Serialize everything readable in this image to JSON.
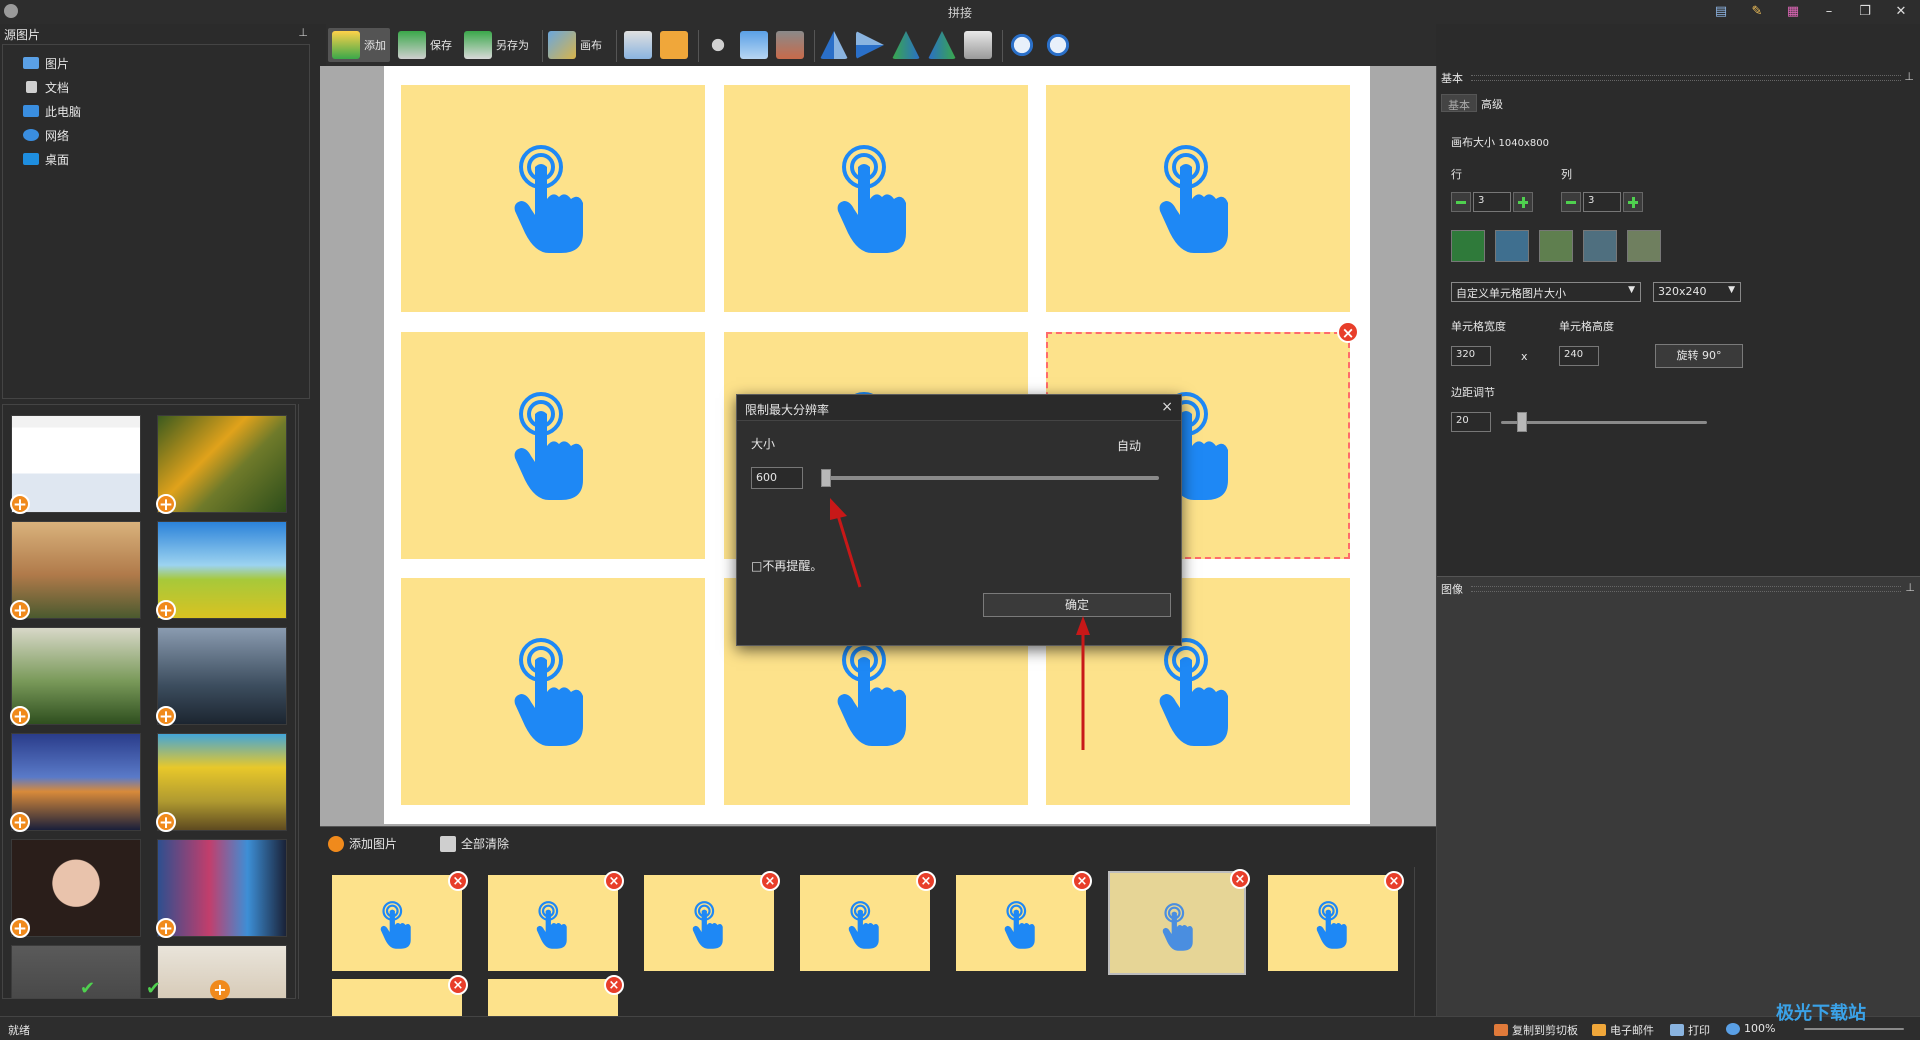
{
  "window": {
    "title": "拼接"
  },
  "left_panel": {
    "header": "源图片",
    "pin": "ᵖ",
    "tree": [
      {
        "label": "图片",
        "color": "#5aa0e6"
      },
      {
        "label": "文档",
        "color": "#d0d0d0"
      },
      {
        "label": "此电脑",
        "color": "#3a8ee0"
      },
      {
        "label": "网络",
        "color": "#3a8ee0"
      },
      {
        "label": "桌面",
        "color": "#1e8ee0"
      }
    ],
    "bottom_actions": [
      "✔",
      "✔",
      "+"
    ]
  },
  "toolbar": {
    "add": "添加",
    "save": "保存",
    "save_as": "另存为",
    "canvas": "画布"
  },
  "dialog": {
    "title": "限制最大分辨率",
    "size_label": "大小",
    "auto_label": "自动",
    "size_value": "600",
    "slider_level": 0,
    "no_remind": "□不再提醒。",
    "ok_button": "确定",
    "close": "×"
  },
  "bottom_strip": {
    "add_images": "添加图片",
    "clear_all": "全部清除"
  },
  "right_panel": {
    "basic_header": "基本",
    "tabs": [
      "基本",
      "高级"
    ],
    "canvas_size_label": "画布大小",
    "canvas_size_value": "1040x800",
    "rows_label": "行",
    "cols_label": "列",
    "rows_value": "3",
    "cols_value": "3",
    "cell_size_mode": "自定义单元格图片大小",
    "cell_size_preset": "320x240",
    "cell_width_label": "单元格宽度",
    "cell_height_label": "单元格高度",
    "cell_width": "320",
    "x_sep": "x",
    "cell_height": "240",
    "rotate_button": "旋转 90°",
    "margin_label": "边距调节",
    "margin_value": "20",
    "image_header": "图像"
  },
  "status_bar": {
    "status": "就绪",
    "copy_clipboard": "复制到剪切板",
    "email": "电子邮件",
    "print": "打印",
    "zoom": "100%",
    "watermark": "极光下载站"
  },
  "colors": {
    "accent_orange": "#f08a1c",
    "delete_red": "#e83e2a",
    "cell_yellow": "#fde28b",
    "hand_blue": "#1e88f5",
    "arrow_red": "#c81818"
  }
}
